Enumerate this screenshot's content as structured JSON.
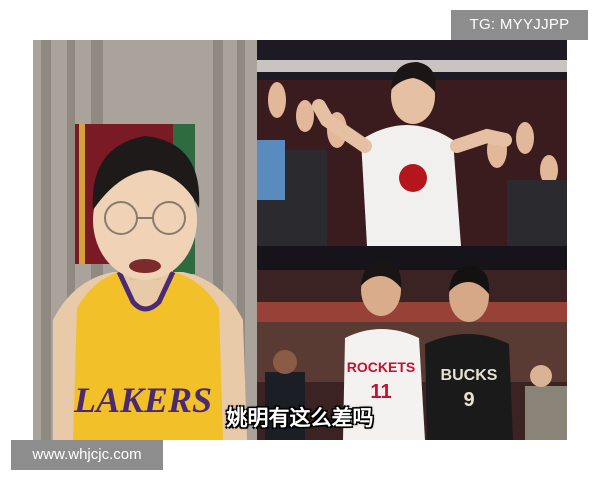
{
  "watermarks": {
    "top_right": "TG: MYYJJPP",
    "bottom_left": "www.whjcjc.com"
  },
  "video": {
    "subtitle": "姚明有这么差吗"
  },
  "jerseys": {
    "streamer": "LAKERS",
    "left_player": "ROCKETS",
    "right_player": "BUCKS",
    "left_number": "11",
    "right_number": "9"
  },
  "colors": {
    "lakers_gold": "#f2c029",
    "lakers_purple": "#4a2a73",
    "rockets_red": "#c8102e",
    "bucks_black": "#1a1a1a",
    "watermark_bg": "#8d8d8d"
  }
}
